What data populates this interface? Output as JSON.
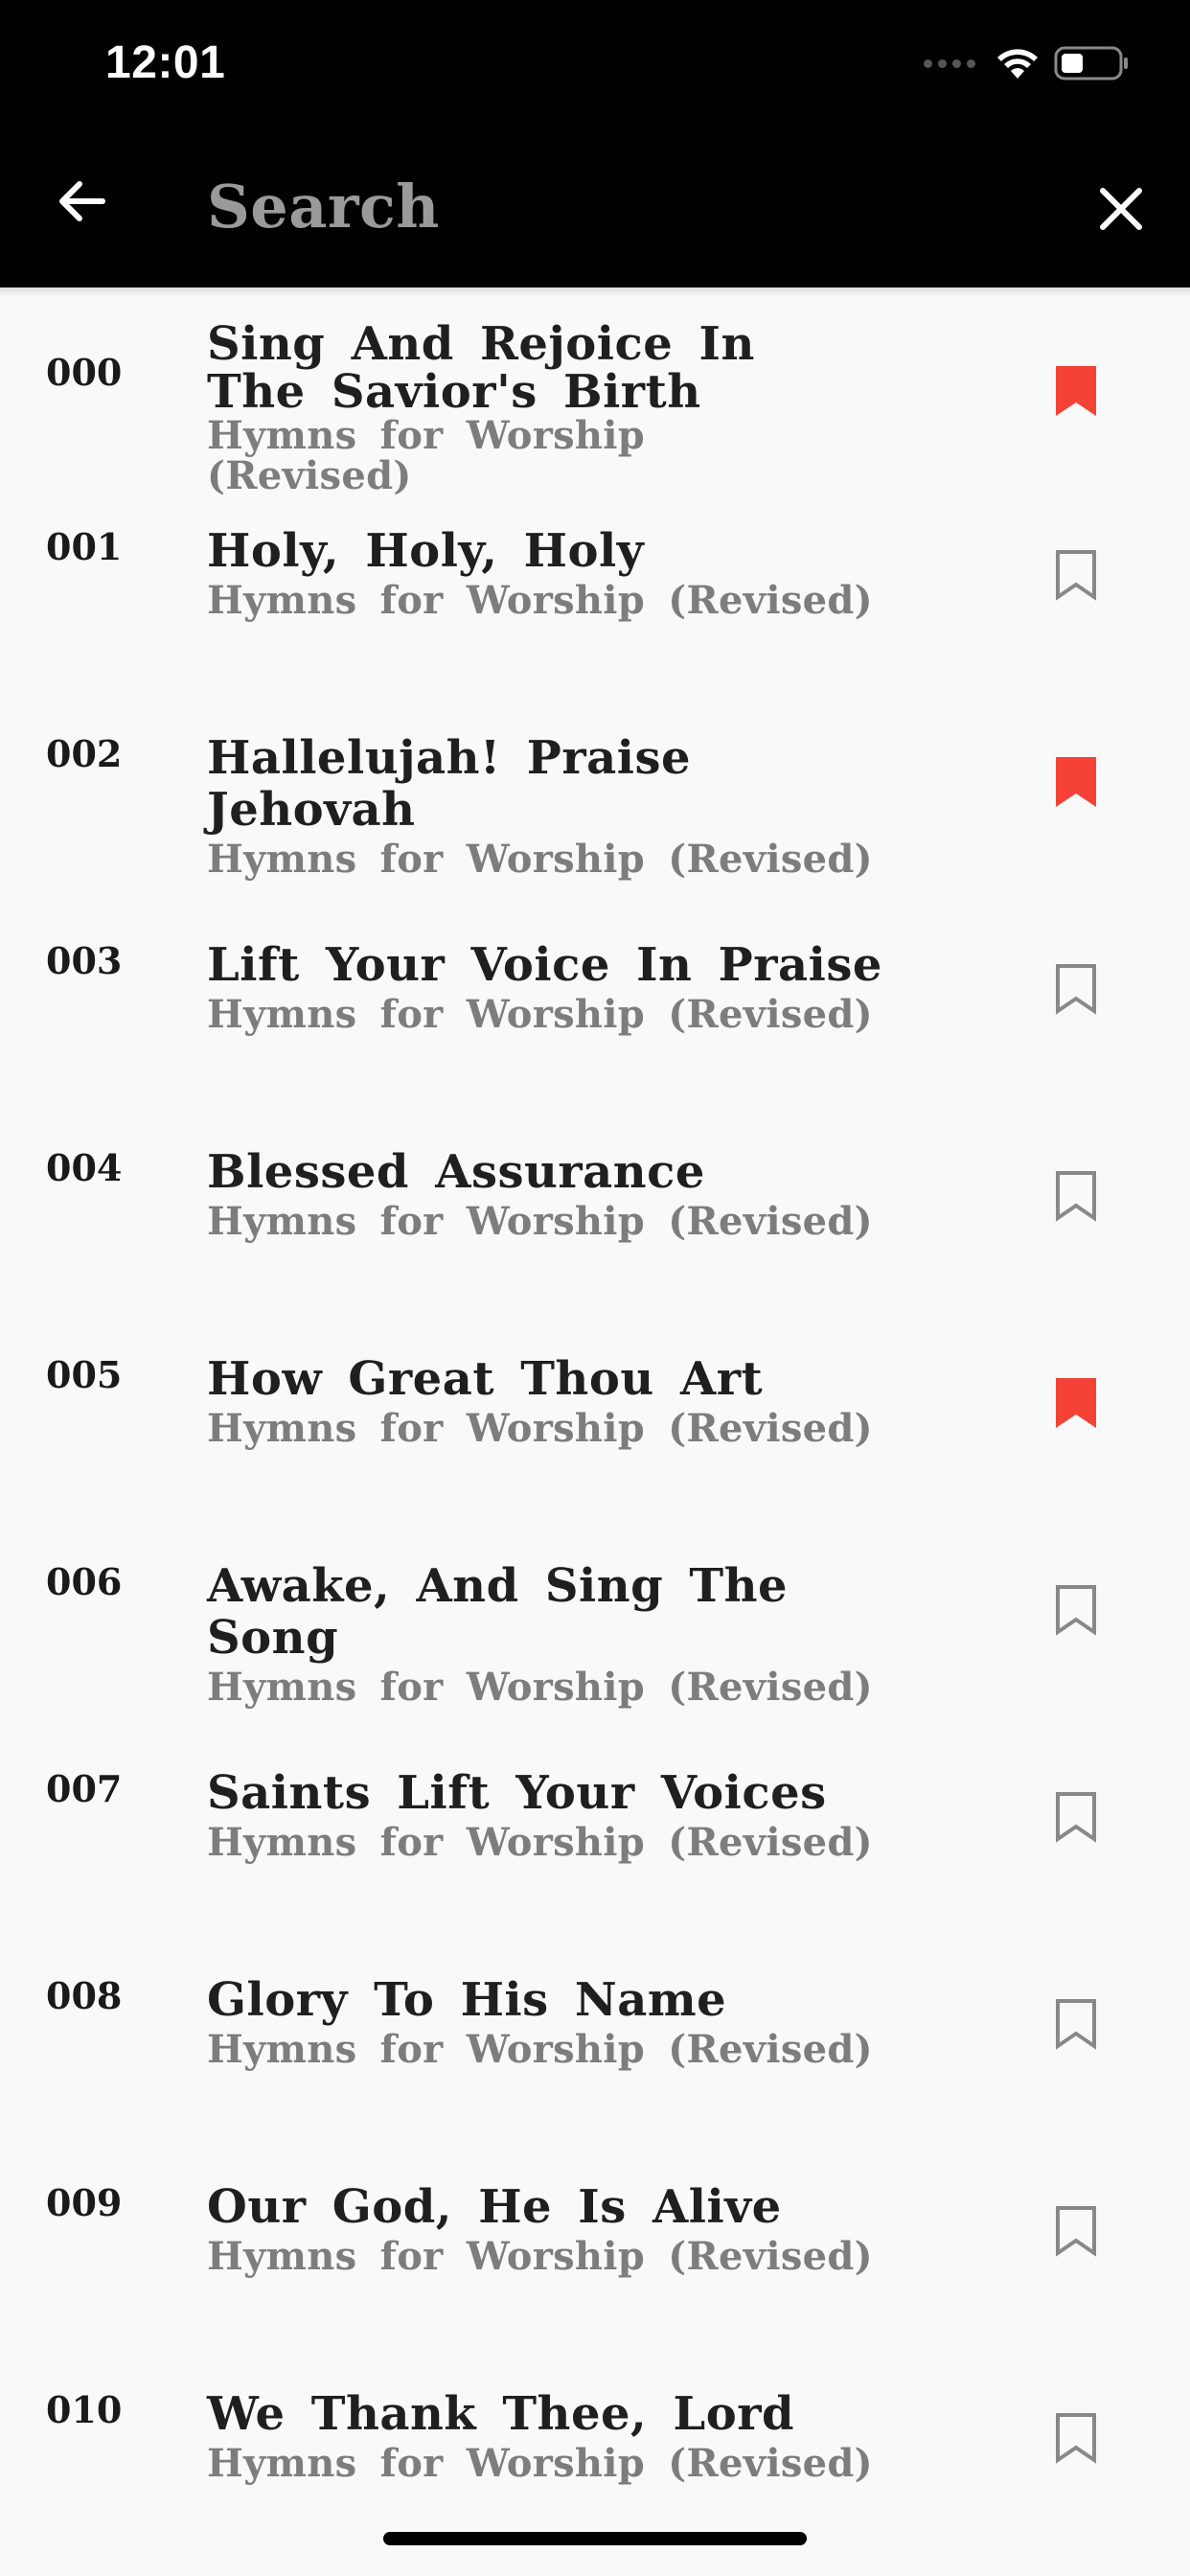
{
  "status_bar": {
    "time": "12:01"
  },
  "header": {
    "search_placeholder": "Search",
    "back_icon": "arrow-left-icon",
    "close_icon": "close-icon"
  },
  "colors": {
    "bookmark_active": "#f44336",
    "bookmark_inactive": "#888888",
    "app_bar": "#000000"
  },
  "hymns": [
    {
      "number": "000",
      "title": "Sing And Rejoice In The Savior's Birth",
      "book": "Hymns for Worship (Revised)",
      "bookmarked": true
    },
    {
      "number": "001",
      "title": "Holy, Holy, Holy",
      "book": "Hymns for Worship (Revised)",
      "bookmarked": false
    },
    {
      "number": "002",
      "title": "Hallelujah! Praise Jehovah",
      "book": "Hymns for Worship (Revised)",
      "bookmarked": true
    },
    {
      "number": "003",
      "title": "Lift Your Voice In Praise",
      "book": "Hymns for Worship (Revised)",
      "bookmarked": false
    },
    {
      "number": "004",
      "title": "Blessed Assurance",
      "book": "Hymns for Worship (Revised)",
      "bookmarked": false
    },
    {
      "number": "005",
      "title": "How Great Thou Art",
      "book": "Hymns for Worship (Revised)",
      "bookmarked": true
    },
    {
      "number": "006",
      "title": "Awake, And Sing The Song",
      "book": "Hymns for Worship (Revised)",
      "bookmarked": false
    },
    {
      "number": "007",
      "title": "Saints Lift Your Voices",
      "book": "Hymns for Worship (Revised)",
      "bookmarked": false
    },
    {
      "number": "008",
      "title": "Glory To His Name",
      "book": "Hymns for Worship (Revised)",
      "bookmarked": false
    },
    {
      "number": "009",
      "title": "Our God, He Is Alive",
      "book": "Hymns for Worship (Revised)",
      "bookmarked": false
    },
    {
      "number": "010",
      "title": "We Thank Thee, Lord",
      "book": "Hymns for Worship (Revised)",
      "bookmarked": false
    }
  ]
}
